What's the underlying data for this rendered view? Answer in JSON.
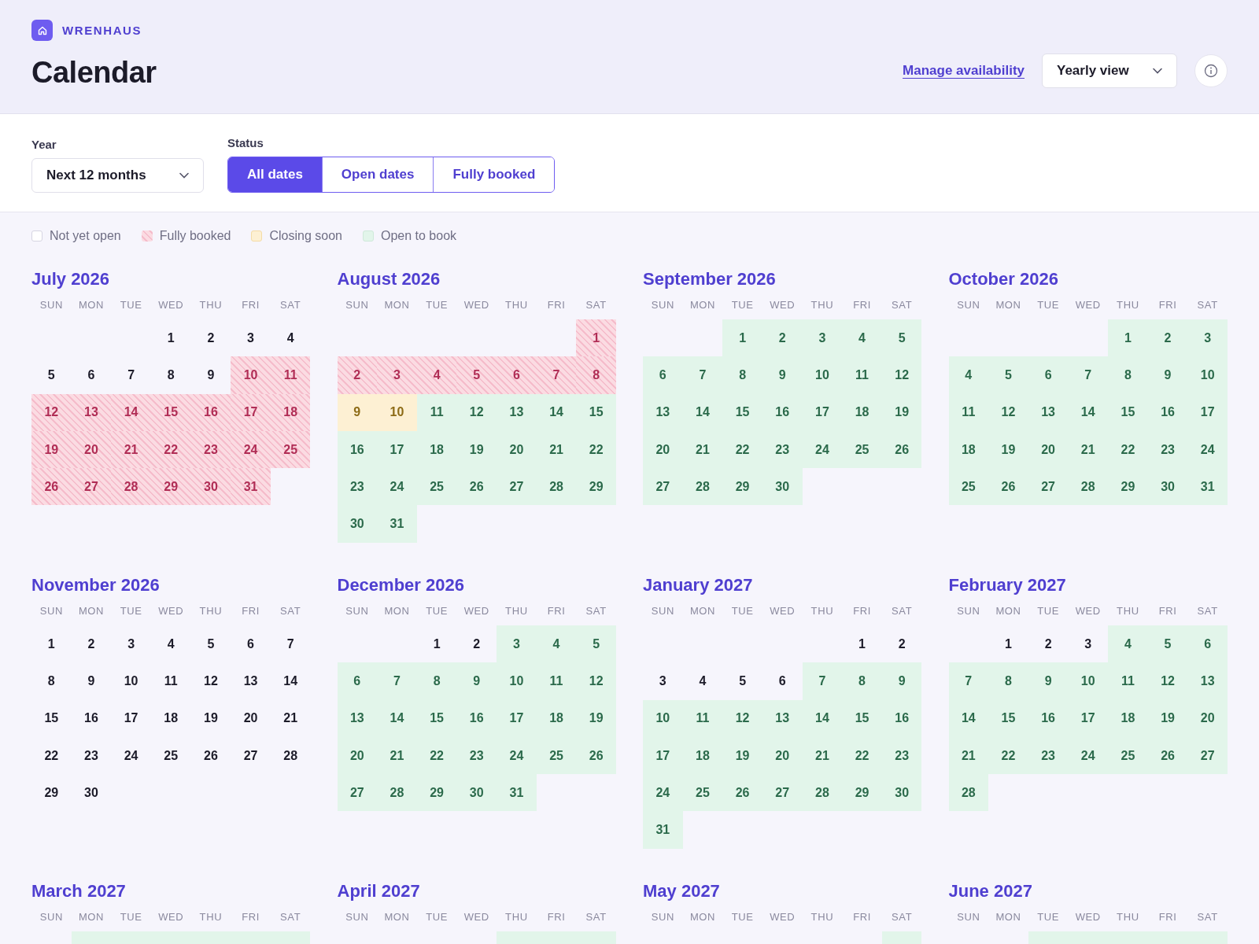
{
  "brand": {
    "name": "WRENHAUS"
  },
  "page_title": "Calendar",
  "header_actions": {
    "link": "Manage availability",
    "view_select": {
      "value": "Yearly view"
    }
  },
  "filters": {
    "year": {
      "label": "Year",
      "value": "Next 12 months"
    },
    "status": {
      "label": "Status",
      "options": [
        {
          "label": "All dates",
          "selected": true
        },
        {
          "label": "Open dates",
          "selected": false
        },
        {
          "label": "Fully booked",
          "selected": false
        }
      ]
    }
  },
  "legend": [
    {
      "label": "Not yet open",
      "kind": "none"
    },
    {
      "label": "Fully booked",
      "kind": "booked"
    },
    {
      "label": "Closing soon",
      "kind": "closing"
    },
    {
      "label": "Open to book",
      "kind": "open"
    }
  ],
  "months": [
    {
      "title": "July 2026",
      "weekdays": [
        "SUN",
        "MON",
        "TUE",
        "WED",
        "THU",
        "FRI",
        "SAT"
      ],
      "cells": [
        {
          "kind": "blank"
        },
        {
          "kind": "blank"
        },
        {
          "kind": "blank"
        },
        {
          "day": "1",
          "kind": "none"
        },
        {
          "day": "2",
          "kind": "none"
        },
        {
          "day": "3",
          "kind": "none"
        },
        {
          "day": "4",
          "kind": "none"
        },
        {
          "day": "5",
          "kind": "none"
        },
        {
          "day": "6",
          "kind": "none"
        },
        {
          "day": "7",
          "kind": "none"
        },
        {
          "day": "8",
          "kind": "none"
        },
        {
          "day": "9",
          "kind": "none"
        },
        {
          "day": "10",
          "kind": "booked"
        },
        {
          "day": "11",
          "kind": "booked"
        },
        {
          "day": "12",
          "kind": "booked"
        },
        {
          "day": "13",
          "kind": "booked"
        },
        {
          "day": "14",
          "kind": "booked"
        },
        {
          "day": "15",
          "kind": "booked"
        },
        {
          "day": "16",
          "kind": "booked"
        },
        {
          "day": "17",
          "kind": "booked"
        },
        {
          "day": "18",
          "kind": "booked"
        },
        {
          "day": "19",
          "kind": "booked"
        },
        {
          "day": "20",
          "kind": "booked"
        },
        {
          "day": "21",
          "kind": "booked"
        },
        {
          "day": "22",
          "kind": "booked"
        },
        {
          "day": "23",
          "kind": "booked"
        },
        {
          "day": "24",
          "kind": "booked"
        },
        {
          "day": "25",
          "kind": "booked"
        },
        {
          "day": "26",
          "kind": "booked"
        },
        {
          "day": "27",
          "kind": "booked"
        },
        {
          "day": "28",
          "kind": "booked"
        },
        {
          "day": "29",
          "kind": "booked"
        },
        {
          "day": "30",
          "kind": "booked"
        },
        {
          "day": "31",
          "kind": "booked"
        }
      ]
    },
    {
      "title": "August 2026",
      "weekdays": [
        "SUN",
        "MON",
        "TUE",
        "WED",
        "THU",
        "FRI",
        "SAT"
      ],
      "cells": [
        {
          "kind": "blank"
        },
        {
          "kind": "blank"
        },
        {
          "kind": "blank"
        },
        {
          "kind": "blank"
        },
        {
          "kind": "blank"
        },
        {
          "kind": "blank"
        },
        {
          "day": "1",
          "kind": "booked"
        },
        {
          "day": "2",
          "kind": "booked"
        },
        {
          "day": "3",
          "kind": "booked"
        },
        {
          "day": "4",
          "kind": "booked"
        },
        {
          "day": "5",
          "kind": "booked"
        },
        {
          "day": "6",
          "kind": "booked"
        },
        {
          "day": "7",
          "kind": "booked"
        },
        {
          "day": "8",
          "kind": "booked"
        },
        {
          "day": "9",
          "kind": "closing"
        },
        {
          "day": "10",
          "kind": "closing"
        },
        {
          "day": "11",
          "kind": "open"
        },
        {
          "day": "12",
          "kind": "open"
        },
        {
          "day": "13",
          "kind": "open"
        },
        {
          "day": "14",
          "kind": "open"
        },
        {
          "day": "15",
          "kind": "open"
        },
        {
          "day": "16",
          "kind": "open"
        },
        {
          "day": "17",
          "kind": "open"
        },
        {
          "day": "18",
          "kind": "open"
        },
        {
          "day": "19",
          "kind": "open"
        },
        {
          "day": "20",
          "kind": "open"
        },
        {
          "day": "21",
          "kind": "open"
        },
        {
          "day": "22",
          "kind": "open"
        },
        {
          "day": "23",
          "kind": "open"
        },
        {
          "day": "24",
          "kind": "open"
        },
        {
          "day": "25",
          "kind": "open"
        },
        {
          "day": "26",
          "kind": "open"
        },
        {
          "day": "27",
          "kind": "open"
        },
        {
          "day": "28",
          "kind": "open"
        },
        {
          "day": "29",
          "kind": "open"
        },
        {
          "day": "30",
          "kind": "open"
        },
        {
          "day": "31",
          "kind": "open"
        }
      ]
    },
    {
      "title": "September 2026",
      "weekdays": [
        "SUN",
        "MON",
        "TUE",
        "WED",
        "THU",
        "FRI",
        "SAT"
      ],
      "cells": [
        {
          "kind": "blank"
        },
        {
          "kind": "blank"
        },
        {
          "day": "1",
          "kind": "open"
        },
        {
          "day": "2",
          "kind": "open"
        },
        {
          "day": "3",
          "kind": "open"
        },
        {
          "day": "4",
          "kind": "open"
        },
        {
          "day": "5",
          "kind": "open"
        },
        {
          "day": "6",
          "kind": "open"
        },
        {
          "day": "7",
          "kind": "open"
        },
        {
          "day": "8",
          "kind": "open"
        },
        {
          "day": "9",
          "kind": "open"
        },
        {
          "day": "10",
          "kind": "open"
        },
        {
          "day": "11",
          "kind": "open"
        },
        {
          "day": "12",
          "kind": "open"
        },
        {
          "day": "13",
          "kind": "open"
        },
        {
          "day": "14",
          "kind": "open"
        },
        {
          "day": "15",
          "kind": "open"
        },
        {
          "day": "16",
          "kind": "open"
        },
        {
          "day": "17",
          "kind": "open"
        },
        {
          "day": "18",
          "kind": "open"
        },
        {
          "day": "19",
          "kind": "open"
        },
        {
          "day": "20",
          "kind": "open"
        },
        {
          "day": "21",
          "kind": "open"
        },
        {
          "day": "22",
          "kind": "open"
        },
        {
          "day": "23",
          "kind": "open"
        },
        {
          "day": "24",
          "kind": "open"
        },
        {
          "day": "25",
          "kind": "open"
        },
        {
          "day": "26",
          "kind": "open"
        },
        {
          "day": "27",
          "kind": "open"
        },
        {
          "day": "28",
          "kind": "open"
        },
        {
          "day": "29",
          "kind": "open"
        },
        {
          "day": "30",
          "kind": "open"
        }
      ]
    },
    {
      "title": "October 2026",
      "weekdays": [
        "SUN",
        "MON",
        "TUE",
        "WED",
        "THU",
        "FRI",
        "SAT"
      ],
      "cells": [
        {
          "kind": "blank"
        },
        {
          "kind": "blank"
        },
        {
          "kind": "blank"
        },
        {
          "kind": "blank"
        },
        {
          "day": "1",
          "kind": "open"
        },
        {
          "day": "2",
          "kind": "open"
        },
        {
          "day": "3",
          "kind": "open"
        },
        {
          "day": "4",
          "kind": "open"
        },
        {
          "day": "5",
          "kind": "open"
        },
        {
          "day": "6",
          "kind": "open"
        },
        {
          "day": "7",
          "kind": "open"
        },
        {
          "day": "8",
          "kind": "open"
        },
        {
          "day": "9",
          "kind": "open"
        },
        {
          "day": "10",
          "kind": "open"
        },
        {
          "day": "11",
          "kind": "open"
        },
        {
          "day": "12",
          "kind": "open"
        },
        {
          "day": "13",
          "kind": "open"
        },
        {
          "day": "14",
          "kind": "open"
        },
        {
          "day": "15",
          "kind": "open"
        },
        {
          "day": "16",
          "kind": "open"
        },
        {
          "day": "17",
          "kind": "open"
        },
        {
          "day": "18",
          "kind": "open"
        },
        {
          "day": "19",
          "kind": "open"
        },
        {
          "day": "20",
          "kind": "open"
        },
        {
          "day": "21",
          "kind": "open"
        },
        {
          "day": "22",
          "kind": "open"
        },
        {
          "day": "23",
          "kind": "open"
        },
        {
          "day": "24",
          "kind": "open"
        },
        {
          "day": "25",
          "kind": "open"
        },
        {
          "day": "26",
          "kind": "open"
        },
        {
          "day": "27",
          "kind": "open"
        },
        {
          "day": "28",
          "kind": "open"
        },
        {
          "day": "29",
          "kind": "open"
        },
        {
          "day": "30",
          "kind": "open"
        },
        {
          "day": "31",
          "kind": "open"
        }
      ]
    },
    {
      "title": "November 2026",
      "weekdays": [
        "SUN",
        "MON",
        "TUE",
        "WED",
        "THU",
        "FRI",
        "SAT"
      ],
      "cells": [
        {
          "day": "1",
          "kind": "none"
        },
        {
          "day": "2",
          "kind": "none"
        },
        {
          "day": "3",
          "kind": "none"
        },
        {
          "day": "4",
          "kind": "none"
        },
        {
          "day": "5",
          "kind": "none"
        },
        {
          "day": "6",
          "kind": "none"
        },
        {
          "day": "7",
          "kind": "none"
        },
        {
          "day": "8",
          "kind": "none"
        },
        {
          "day": "9",
          "kind": "none"
        },
        {
          "day": "10",
          "kind": "none"
        },
        {
          "day": "11",
          "kind": "none"
        },
        {
          "day": "12",
          "kind": "none"
        },
        {
          "day": "13",
          "kind": "none"
        },
        {
          "day": "14",
          "kind": "none"
        },
        {
          "day": "15",
          "kind": "none"
        },
        {
          "day": "16",
          "kind": "none"
        },
        {
          "day": "17",
          "kind": "none"
        },
        {
          "day": "18",
          "kind": "none"
        },
        {
          "day": "19",
          "kind": "none"
        },
        {
          "day": "20",
          "kind": "none"
        },
        {
          "day": "21",
          "kind": "none"
        },
        {
          "day": "22",
          "kind": "none"
        },
        {
          "day": "23",
          "kind": "none"
        },
        {
          "day": "24",
          "kind": "none"
        },
        {
          "day": "25",
          "kind": "none"
        },
        {
          "day": "26",
          "kind": "none"
        },
        {
          "day": "27",
          "kind": "none"
        },
        {
          "day": "28",
          "kind": "none"
        },
        {
          "day": "29",
          "kind": "none"
        },
        {
          "day": "30",
          "kind": "none"
        }
      ]
    },
    {
      "title": "December 2026",
      "weekdays": [
        "SUN",
        "MON",
        "TUE",
        "WED",
        "THU",
        "FRI",
        "SAT"
      ],
      "cells": [
        {
          "kind": "blank"
        },
        {
          "kind": "blank"
        },
        {
          "day": "1",
          "kind": "none"
        },
        {
          "day": "2",
          "kind": "none"
        },
        {
          "day": "3",
          "kind": "open"
        },
        {
          "day": "4",
          "kind": "open"
        },
        {
          "day": "5",
          "kind": "open"
        },
        {
          "day": "6",
          "kind": "open"
        },
        {
          "day": "7",
          "kind": "open"
        },
        {
          "day": "8",
          "kind": "open"
        },
        {
          "day": "9",
          "kind": "open"
        },
        {
          "day": "10",
          "kind": "open"
        },
        {
          "day": "11",
          "kind": "open"
        },
        {
          "day": "12",
          "kind": "open"
        },
        {
          "day": "13",
          "kind": "open"
        },
        {
          "day": "14",
          "kind": "open"
        },
        {
          "day": "15",
          "kind": "open"
        },
        {
          "day": "16",
          "kind": "open"
        },
        {
          "day": "17",
          "kind": "open"
        },
        {
          "day": "18",
          "kind": "open"
        },
        {
          "day": "19",
          "kind": "open"
        },
        {
          "day": "20",
          "kind": "open"
        },
        {
          "day": "21",
          "kind": "open"
        },
        {
          "day": "22",
          "kind": "open"
        },
        {
          "day": "23",
          "kind": "open"
        },
        {
          "day": "24",
          "kind": "open"
        },
        {
          "day": "25",
          "kind": "open"
        },
        {
          "day": "26",
          "kind": "open"
        },
        {
          "day": "27",
          "kind": "open"
        },
        {
          "day": "28",
          "kind": "open"
        },
        {
          "day": "29",
          "kind": "open"
        },
        {
          "day": "30",
          "kind": "open"
        },
        {
          "day": "31",
          "kind": "open"
        }
      ]
    },
    {
      "title": "January 2027",
      "weekdays": [
        "SUN",
        "MON",
        "TUE",
        "WED",
        "THU",
        "FRI",
        "SAT"
      ],
      "cells": [
        {
          "kind": "blank"
        },
        {
          "kind": "blank"
        },
        {
          "kind": "blank"
        },
        {
          "kind": "blank"
        },
        {
          "kind": "blank"
        },
        {
          "day": "1",
          "kind": "none"
        },
        {
          "day": "2",
          "kind": "none"
        },
        {
          "day": "3",
          "kind": "none"
        },
        {
          "day": "4",
          "kind": "none"
        },
        {
          "day": "5",
          "kind": "none"
        },
        {
          "day": "6",
          "kind": "none"
        },
        {
          "day": "7",
          "kind": "open"
        },
        {
          "day": "8",
          "kind": "open"
        },
        {
          "day": "9",
          "kind": "open"
        },
        {
          "day": "10",
          "kind": "open"
        },
        {
          "day": "11",
          "kind": "open"
        },
        {
          "day": "12",
          "kind": "open"
        },
        {
          "day": "13",
          "kind": "open"
        },
        {
          "day": "14",
          "kind": "open"
        },
        {
          "day": "15",
          "kind": "open"
        },
        {
          "day": "16",
          "kind": "open"
        },
        {
          "day": "17",
          "kind": "open"
        },
        {
          "day": "18",
          "kind": "open"
        },
        {
          "day": "19",
          "kind": "open"
        },
        {
          "day": "20",
          "kind": "open"
        },
        {
          "day": "21",
          "kind": "open"
        },
        {
          "day": "22",
          "kind": "open"
        },
        {
          "day": "23",
          "kind": "open"
        },
        {
          "day": "24",
          "kind": "open"
        },
        {
          "day": "25",
          "kind": "open"
        },
        {
          "day": "26",
          "kind": "open"
        },
        {
          "day": "27",
          "kind": "open"
        },
        {
          "day": "28",
          "kind": "open"
        },
        {
          "day": "29",
          "kind": "open"
        },
        {
          "day": "30",
          "kind": "open"
        },
        {
          "day": "31",
          "kind": "open"
        }
      ]
    },
    {
      "title": "February 2027",
      "weekdays": [
        "SUN",
        "MON",
        "TUE",
        "WED",
        "THU",
        "FRI",
        "SAT"
      ],
      "cells": [
        {
          "kind": "blank"
        },
        {
          "day": "1",
          "kind": "none"
        },
        {
          "day": "2",
          "kind": "none"
        },
        {
          "day": "3",
          "kind": "none"
        },
        {
          "day": "4",
          "kind": "open"
        },
        {
          "day": "5",
          "kind": "open"
        },
        {
          "day": "6",
          "kind": "open"
        },
        {
          "day": "7",
          "kind": "open"
        },
        {
          "day": "8",
          "kind": "open"
        },
        {
          "day": "9",
          "kind": "open"
        },
        {
          "day": "10",
          "kind": "open"
        },
        {
          "day": "11",
          "kind": "open"
        },
        {
          "day": "12",
          "kind": "open"
        },
        {
          "day": "13",
          "kind": "open"
        },
        {
          "day": "14",
          "kind": "open"
        },
        {
          "day": "15",
          "kind": "open"
        },
        {
          "day": "16",
          "kind": "open"
        },
        {
          "day": "17",
          "kind": "open"
        },
        {
          "day": "18",
          "kind": "open"
        },
        {
          "day": "19",
          "kind": "open"
        },
        {
          "day": "20",
          "kind": "open"
        },
        {
          "day": "21",
          "kind": "open"
        },
        {
          "day": "22",
          "kind": "open"
        },
        {
          "day": "23",
          "kind": "open"
        },
        {
          "day": "24",
          "kind": "open"
        },
        {
          "day": "25",
          "kind": "open"
        },
        {
          "day": "26",
          "kind": "open"
        },
        {
          "day": "27",
          "kind": "open"
        },
        {
          "day": "28",
          "kind": "open"
        }
      ]
    },
    {
      "title": "March 2027",
      "weekdays": [
        "SUN",
        "MON",
        "TUE",
        "WED",
        "THU",
        "FRI",
        "SAT"
      ],
      "cells": [
        {
          "kind": "blank"
        },
        {
          "kind": "open"
        },
        {
          "kind": "open"
        },
        {
          "kind": "open"
        },
        {
          "kind": "open"
        },
        {
          "kind": "open"
        },
        {
          "kind": "open"
        }
      ]
    },
    {
      "title": "April 2027",
      "weekdays": [
        "SUN",
        "MON",
        "TUE",
        "WED",
        "THU",
        "FRI",
        "SAT"
      ],
      "cells": [
        {
          "kind": "blank"
        },
        {
          "kind": "blank"
        },
        {
          "kind": "blank"
        },
        {
          "kind": "blank"
        },
        {
          "kind": "open"
        },
        {
          "kind": "open"
        },
        {
          "kind": "open"
        }
      ]
    },
    {
      "title": "May 2027",
      "weekdays": [
        "SUN",
        "MON",
        "TUE",
        "WED",
        "THU",
        "FRI",
        "SAT"
      ],
      "cells": [
        {
          "kind": "blank"
        },
        {
          "kind": "blank"
        },
        {
          "kind": "blank"
        },
        {
          "kind": "blank"
        },
        {
          "kind": "blank"
        },
        {
          "kind": "blank"
        },
        {
          "kind": "open"
        }
      ]
    },
    {
      "title": "June 2027",
      "weekdays": [
        "SUN",
        "MON",
        "TUE",
        "WED",
        "THU",
        "FRI",
        "SAT"
      ],
      "cells": [
        {
          "kind": "blank"
        },
        {
          "kind": "blank"
        },
        {
          "kind": "open"
        },
        {
          "kind": "open"
        },
        {
          "kind": "open"
        },
        {
          "kind": "open"
        },
        {
          "kind": "open"
        }
      ]
    }
  ]
}
